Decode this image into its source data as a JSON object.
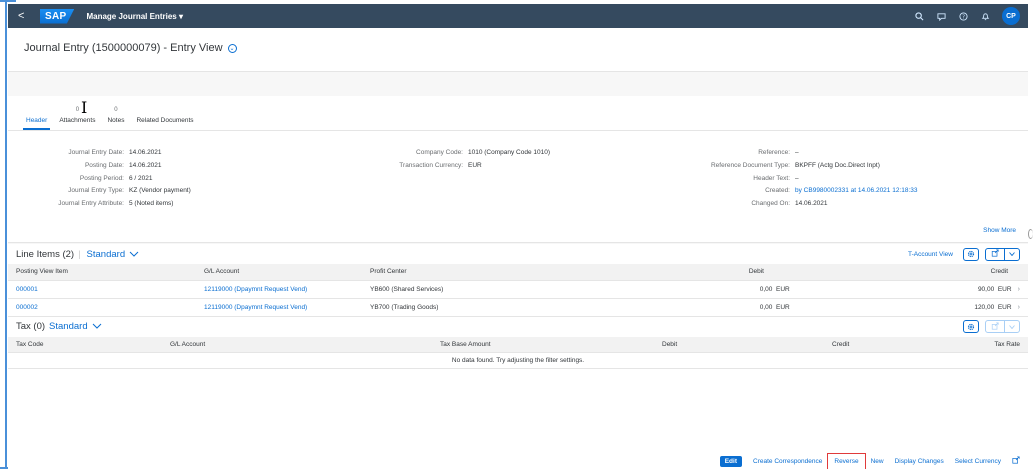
{
  "shell": {
    "back_glyph": "<",
    "logo": "SAP",
    "app_title": "Manage Journal Entries ▾",
    "avatar_initials": "CP",
    "icons": [
      "search-icon",
      "feedback-icon",
      "help-icon",
      "notifications-icon"
    ]
  },
  "header": {
    "title": "Journal Entry (1500000079) - Entry View",
    "title_chevron": "⌄"
  },
  "tabs": [
    {
      "label": "Header",
      "count": "",
      "active": true
    },
    {
      "label": "Attachments",
      "count": "0"
    },
    {
      "label": "Notes",
      "count": "0"
    },
    {
      "label": "Related Documents",
      "count": ""
    }
  ],
  "details": {
    "col1": [
      {
        "label": "Journal Entry Date:",
        "value": "14.06.2021"
      },
      {
        "label": "Posting Date:",
        "value": "14.06.2021"
      },
      {
        "label": "Posting Period:",
        "value": "6 / 2021"
      },
      {
        "label": "Journal Entry Type:",
        "value": "KZ (Vendor payment)"
      },
      {
        "label": "Journal Entry Attribute:",
        "value": "5 (Noted items)"
      }
    ],
    "col2": [
      {
        "label": "Company Code:",
        "value": "1010 (Company Code 1010)"
      },
      {
        "label": "Transaction Currency:",
        "value": "EUR"
      }
    ],
    "col3": [
      {
        "label": "Reference:",
        "value": "–"
      },
      {
        "label": "Reference Document Type:",
        "value": "BKPFF (Actg Doc.Direct Inpt)"
      },
      {
        "label": "Header Text:",
        "value": "–"
      },
      {
        "label": "Created:",
        "value": "by CB9980002331 at 14.06.2021 12:18:33"
      },
      {
        "label": "Changed On:",
        "value": "14.06.2021"
      }
    ],
    "show_more": "Show More"
  },
  "line_items": {
    "title": "Line Items (2)",
    "variant": "Standard",
    "t_account_view": "T-Account View",
    "columns": [
      "Posting View Item",
      "G/L Account",
      "Profit Center",
      "Debit",
      "Credit"
    ],
    "rows": [
      {
        "item": "000001",
        "gl": "12119000 (Dpaymnt Request Vend)",
        "pc": "YB600 (Shared Services)",
        "debit": "0,00",
        "debit_cur": "EUR",
        "credit": "90,00",
        "credit_cur": "EUR"
      },
      {
        "item": "000002",
        "gl": "12119000 (Dpaymnt Request Vend)",
        "pc": "YB700 (Trading Goods)",
        "debit": "0,00",
        "debit_cur": "EUR",
        "credit": "120,00",
        "credit_cur": "EUR"
      }
    ]
  },
  "tax": {
    "title": "Tax (0)",
    "variant": "Standard",
    "columns": [
      "Tax Code",
      "G/L Account",
      "Tax Base Amount",
      "Debit",
      "Credit",
      "Tax Rate"
    ],
    "no_data": "No data found. Try adjusting the filter settings."
  },
  "footer": {
    "edit": "Edit",
    "create_correspondence": "Create Correspondence",
    "reverse": "Reverse",
    "new": "New",
    "display_changes": "Display Changes",
    "select_currency": "Select Currency"
  },
  "colors": {
    "shell": "#354a5f",
    "link": "#0a6ed1",
    "highlight": "#e03a3a"
  }
}
